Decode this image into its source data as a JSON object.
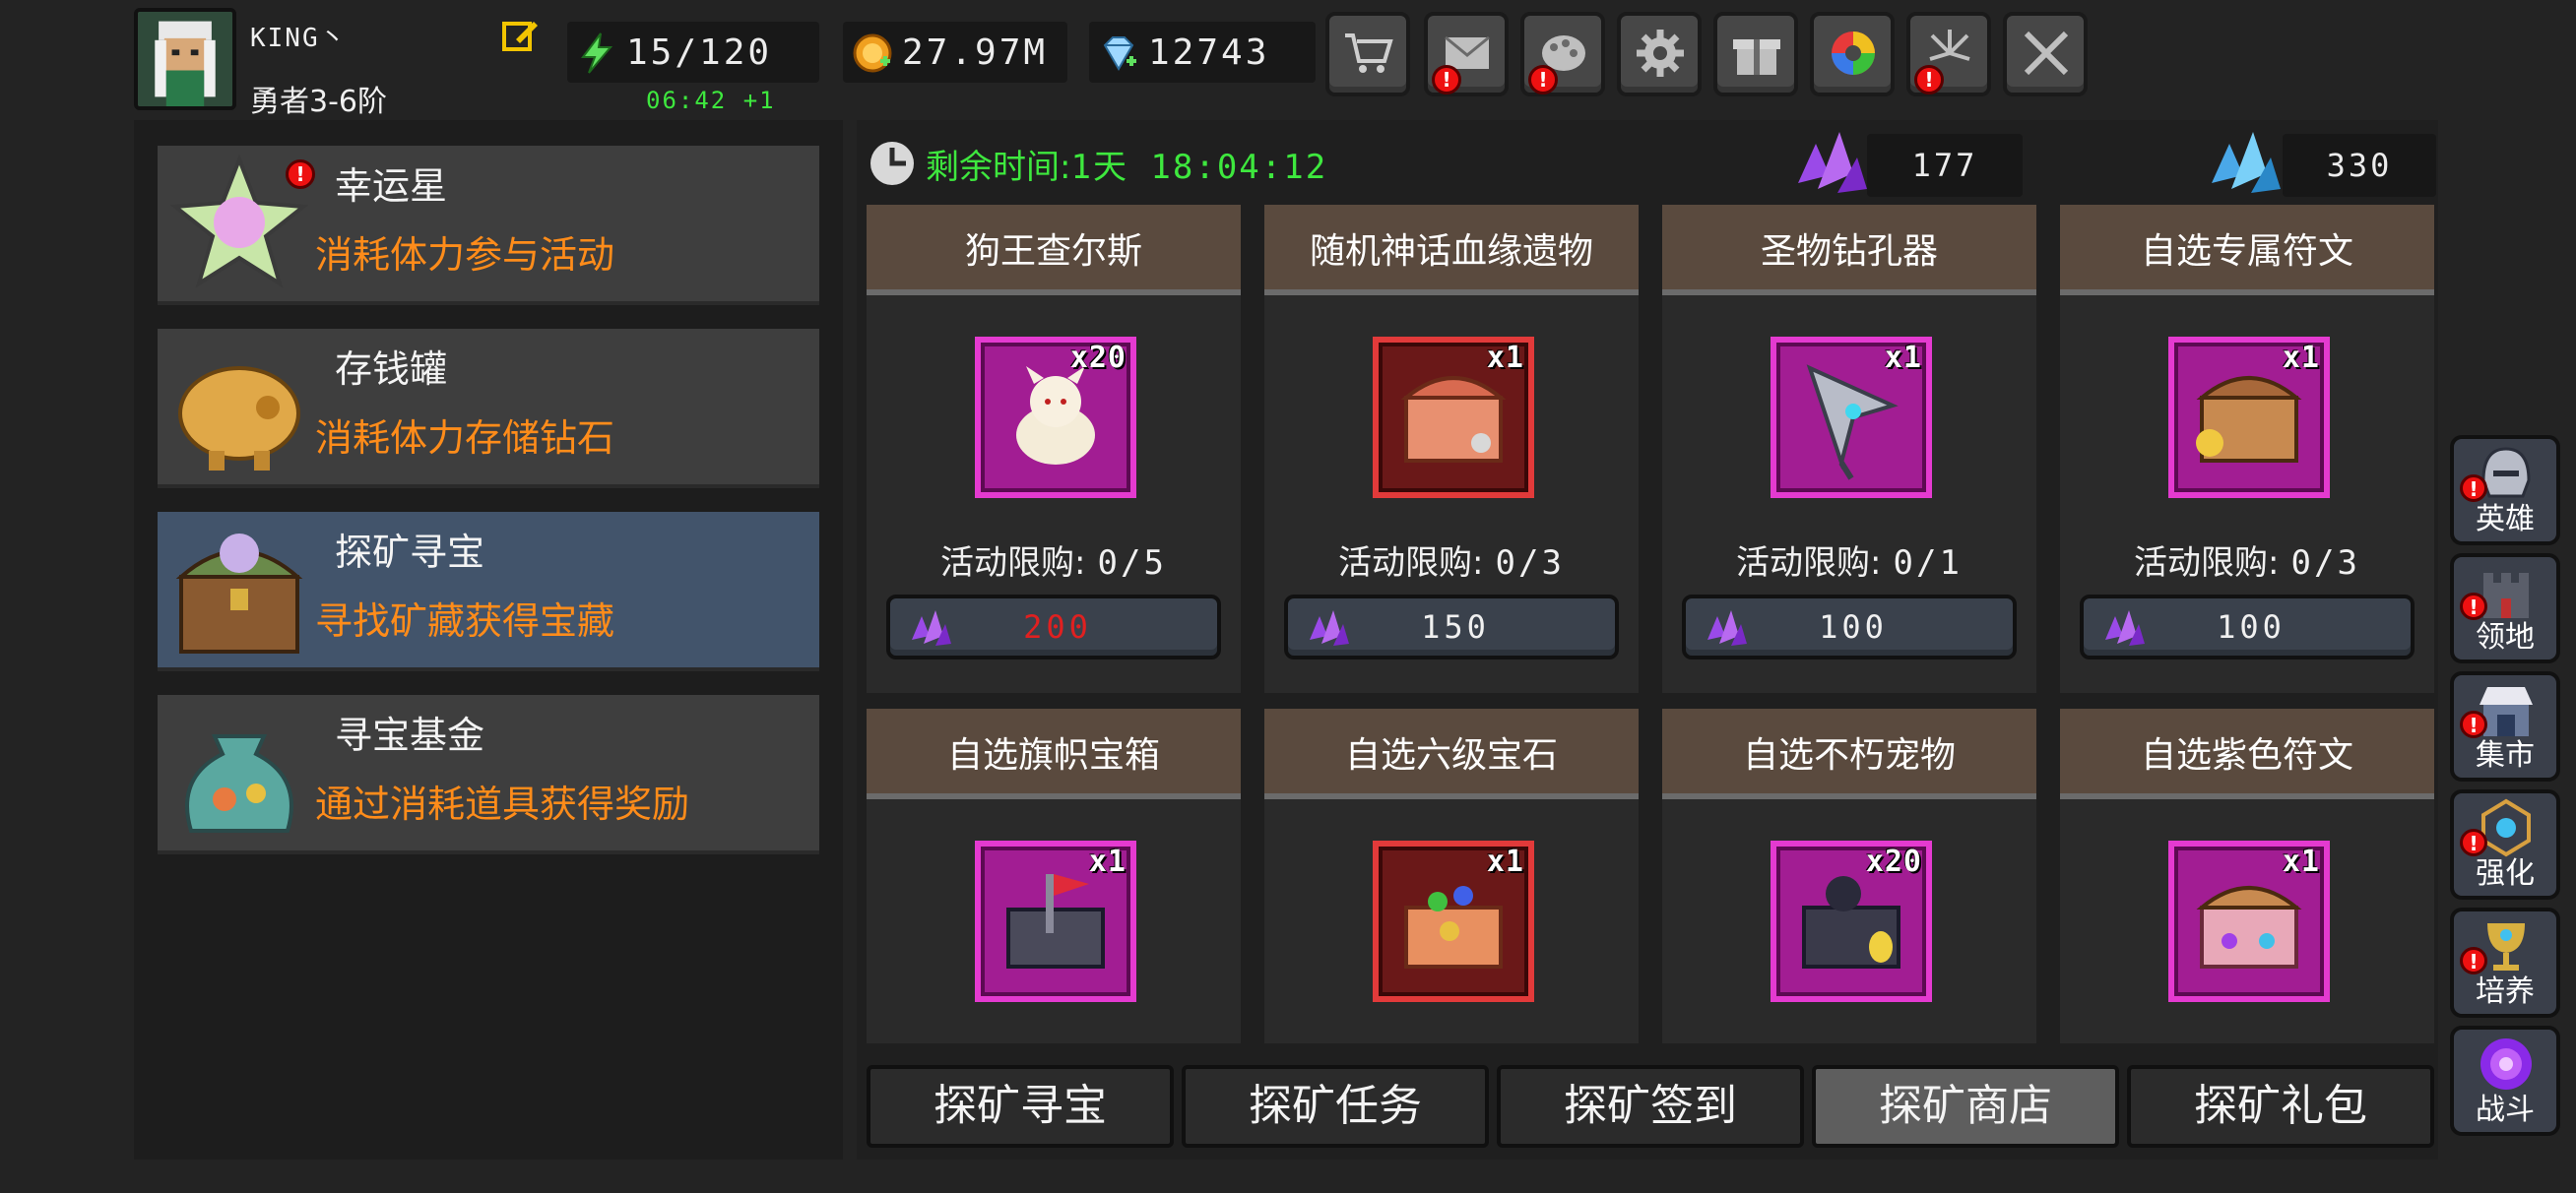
{
  "player": {
    "name": "KING丶",
    "rank": "勇者3-6阶"
  },
  "resources": {
    "energy": "15/120",
    "energy_timer": "06:42 +1",
    "gold": "27.97M",
    "diamonds": "12743"
  },
  "top_buttons": [
    {
      "name": "shop",
      "icon": "cart-icon",
      "alert": false
    },
    {
      "name": "mail",
      "icon": "mail-icon",
      "alert": true
    },
    {
      "name": "palette",
      "icon": "palette-icon",
      "alert": true
    },
    {
      "name": "settings",
      "icon": "gear-icon",
      "alert": false
    },
    {
      "name": "gift",
      "icon": "gift-icon",
      "alert": false
    },
    {
      "name": "wheel",
      "icon": "color-wheel-icon",
      "alert": false
    },
    {
      "name": "fireworks",
      "icon": "fireworks-icon",
      "alert": true
    },
    {
      "name": "battle",
      "icon": "crossed-swords-icon",
      "alert": false
    }
  ],
  "events": [
    {
      "title": "幸运星",
      "desc": "消耗体力参与活动",
      "icon": "lucky-star-icon",
      "alert": true,
      "active": false
    },
    {
      "title": "存钱罐",
      "desc": "消耗体力存储钻石",
      "icon": "piggy-bank-icon",
      "alert": false,
      "active": false
    },
    {
      "title": "探矿寻宝",
      "desc": "寻找矿藏获得宝藏",
      "icon": "treasure-chest-icon",
      "alert": false,
      "active": true
    },
    {
      "title": "寻宝基金",
      "desc": "通过消耗道具获得奖励",
      "icon": "treasure-bag-icon",
      "alert": false,
      "active": false
    }
  ],
  "shop": {
    "timer_label": "剩余时间:",
    "timer_value": "1天 18:04:12",
    "purple_crystals": "177",
    "blue_crystals": "330",
    "limit_label": "活动限购:",
    "items": [
      {
        "name": "狗王查尔斯",
        "qty": "x20",
        "limit": "0/5",
        "price": "200",
        "price_red": true,
        "frame": "purple",
        "icon": "dog-icon"
      },
      {
        "name": "随机神话血缘遗物",
        "qty": "x1",
        "limit": "0/3",
        "price": "150",
        "price_red": false,
        "frame": "red",
        "icon": "relic-chest-icon"
      },
      {
        "name": "圣物钻孔器",
        "qty": "x1",
        "limit": "0/1",
        "price": "100",
        "price_red": false,
        "frame": "purple",
        "icon": "drill-icon"
      },
      {
        "name": "自选专属符文",
        "qty": "x1",
        "limit": "0/3",
        "price": "100",
        "price_red": false,
        "frame": "purple",
        "icon": "rune-chest-icon"
      },
      {
        "name": "自选旗帜宝箱",
        "qty": "x1",
        "frame": "purple",
        "icon": "flag-chest-icon"
      },
      {
        "name": "自选六级宝石",
        "qty": "x1",
        "frame": "red",
        "icon": "gem-chest-icon"
      },
      {
        "name": "自选不朽宠物",
        "qty": "x20",
        "frame": "purple",
        "icon": "pet-chest-icon"
      },
      {
        "name": "自选紫色符文",
        "qty": "x1",
        "frame": "purple",
        "icon": "purple-rune-chest-icon"
      }
    ]
  },
  "tabs": [
    {
      "label": "探矿寻宝",
      "active": false
    },
    {
      "label": "探矿任务",
      "active": false
    },
    {
      "label": "探矿签到",
      "active": false
    },
    {
      "label": "探矿商店",
      "active": true
    },
    {
      "label": "探矿礼包",
      "active": false
    }
  ],
  "side_nav": [
    {
      "label": "英雄",
      "icon": "helmet-icon",
      "alert": true
    },
    {
      "label": "领地",
      "icon": "castle-icon",
      "alert": true
    },
    {
      "label": "集市",
      "icon": "market-icon",
      "alert": true
    },
    {
      "label": "强化",
      "icon": "enhance-icon",
      "alert": true
    },
    {
      "label": "培养",
      "icon": "chalice-icon",
      "alert": true
    },
    {
      "label": "战斗",
      "icon": "portal-icon",
      "alert": false
    }
  ],
  "colors": {
    "accent_green": "#3ee83e",
    "desc_orange": "#ff8c1a",
    "alert_red": "#e11111",
    "active_event_bg": "#42546b",
    "price_red": "#e02020"
  }
}
